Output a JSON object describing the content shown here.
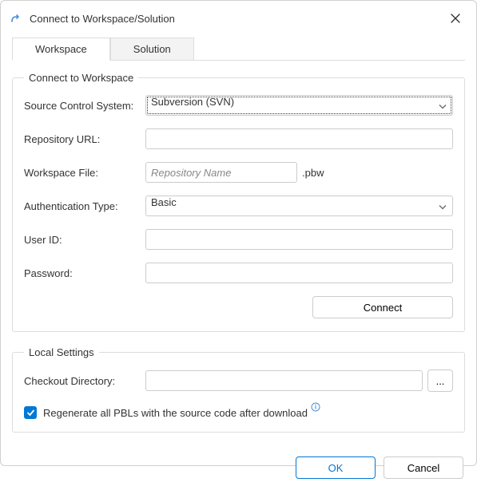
{
  "title": "Connect to Workspace/Solution",
  "tabs": {
    "workspace": "Workspace",
    "solution": "Solution"
  },
  "group1": {
    "legend": "Connect to Workspace",
    "scs_label": "Source Control System:",
    "scs_value": "Subversion (SVN)",
    "repo_label": "Repository URL:",
    "repo_value": "",
    "wsfile_label": "Workspace File:",
    "wsfile_placeholder": "Repository Name",
    "wsfile_suffix": ".pbw",
    "auth_label": "Authentication Type:",
    "auth_value": "Basic",
    "user_label": "User ID:",
    "user_value": "",
    "pass_label": "Password:",
    "pass_value": "",
    "connect_btn": "Connect"
  },
  "group2": {
    "legend": "Local Settings",
    "checkout_label": "Checkout Directory:",
    "checkout_value": "",
    "browse_btn": "...",
    "regen_label": "Regenerate all PBLs with the source code after download"
  },
  "footer": {
    "ok": "OK",
    "cancel": "Cancel"
  }
}
